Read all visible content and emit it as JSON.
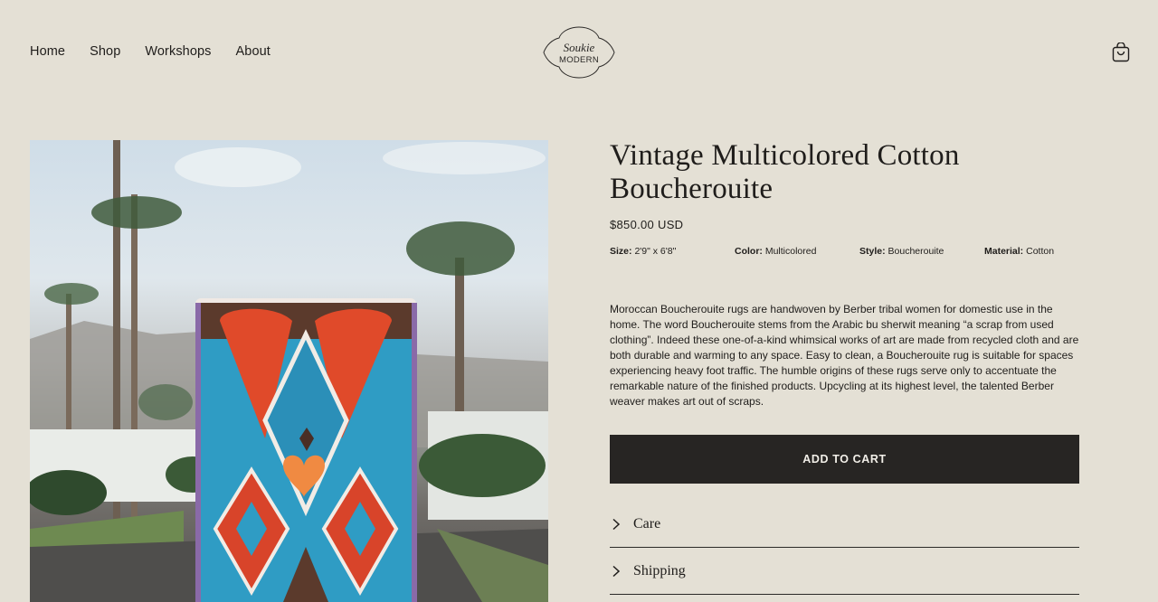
{
  "nav": {
    "items": [
      "Home",
      "Shop",
      "Workshops",
      "About"
    ]
  },
  "brand": {
    "logo_line1": "Soukie",
    "logo_line2": "MODERN"
  },
  "icons": {
    "cart": "shopping-bag-icon",
    "chevron": "chevron-right-icon"
  },
  "product": {
    "title": "Vintage Multicolored Cotton Boucherouite",
    "price": "$850.00 USD",
    "specs": [
      {
        "label": "Size:",
        "value": "2'9\" x 6'8\""
      },
      {
        "label": "Color:",
        "value": "Multicolored"
      },
      {
        "label": "Style:",
        "value": "Boucherouite"
      },
      {
        "label": "Material:",
        "value": "Cotton"
      }
    ],
    "description": "Moroccan Boucherouite rugs are handwoven by Berber tribal women for domestic use in the home. The word Boucherouite stems from the Arabic bu sherwit meaning “a scrap from used clothing”. Indeed these one-of-a-kind whimsical works of art are made from recycled cloth and are both durable and warming to any space. Easy to clean, a Boucherouite rug is suitable for spaces experiencing heavy foot traffic. The humble origins of these rugs serve only to accentuate the remarkable nature of the finished products. Upcycling at its highest level, the talented Berber weaver makes art out of scraps.",
    "add_to_cart": "ADD TO CART"
  },
  "accordion": [
    "Care",
    "Shipping"
  ],
  "colors": {
    "background": "#e4e0d5",
    "button": "#272523",
    "text": "#1f1d1b"
  }
}
